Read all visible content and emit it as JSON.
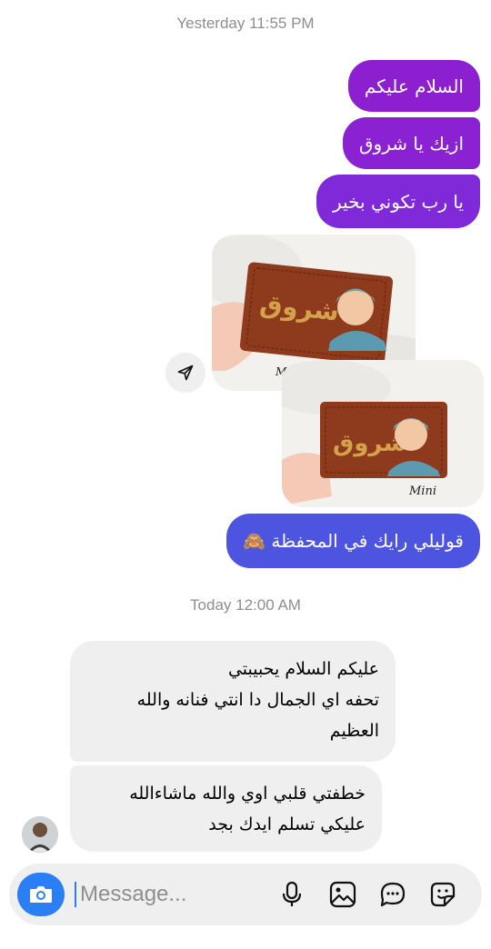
{
  "thread": {
    "timestamp_1": "Yesterday 11:55 PM",
    "timestamp_2": "Today 12:00 AM",
    "outgoing": [
      "السلام عليكم",
      "ازيك يا شروق",
      "يا رب تكوني بخير"
    ],
    "caption": "قوليلي رايك في المحفظة 🙈",
    "incoming_1": [
      "عليكم السلام يحبيبتي",
      "تحفه اي الجمال دا انتي فنانه والله",
      "العظيم"
    ],
    "incoming_2": [
      "خطفتي قلبي اوي والله ماشاءالله",
      "عليكي تسلم ايدك بجد"
    ],
    "photo_text": {
      "name": "شروق",
      "brand": "Mini"
    }
  },
  "composer": {
    "placeholder": "Message..."
  },
  "icons": {
    "share": "paper-plane-icon",
    "camera": "camera-icon",
    "mic": "microphone-icon",
    "gallery": "image-icon",
    "chat": "chat-bubble-icon",
    "sticker": "sticker-icon"
  },
  "colors": {
    "outgoing_top": "#8c1fd0",
    "outgoing_bottom": "#4d54e0",
    "incoming": "#efefef",
    "camera_button": "#2a7ff5"
  }
}
